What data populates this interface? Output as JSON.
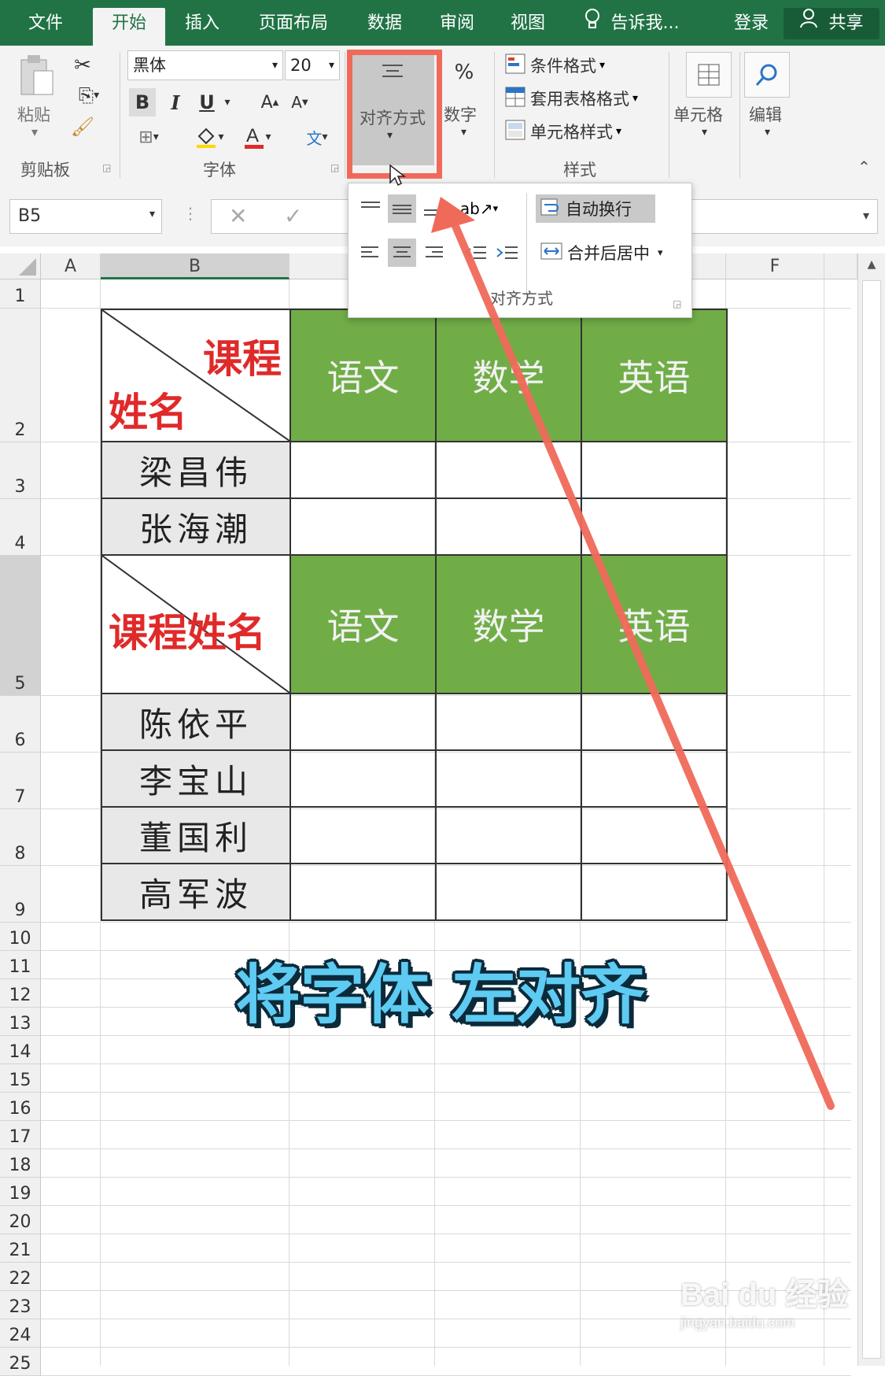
{
  "tabs": {
    "file": "文件",
    "home": "开始",
    "insert": "插入",
    "layout": "页面布局",
    "data": "数据",
    "review": "审阅",
    "view": "视图",
    "tell_me": "告诉我...",
    "login": "登录",
    "share": "共享"
  },
  "ribbon": {
    "paste": "粘贴",
    "clipboard_group": "剪贴板",
    "font_name": "黑体",
    "font_size": "20",
    "font_group": "字体",
    "bold": "B",
    "italic": "I",
    "underline": "U",
    "alignment_button": "对齐方式",
    "number_button": "数字",
    "conditional_format": "条件格式",
    "table_format": "套用表格格式",
    "cell_styles": "单元格样式",
    "styles_group": "样式",
    "cells_button": "单元格",
    "edit_button": "编辑"
  },
  "formula_bar": {
    "name_box": "B5"
  },
  "dropdown": {
    "wrap_text": "自动换行",
    "merge_center": "合并后居中",
    "group_label": "对齐方式"
  },
  "columns": [
    "A",
    "B",
    "F"
  ],
  "rows": [
    "1",
    "2",
    "3",
    "4",
    "5",
    "6",
    "7",
    "8",
    "9",
    "10",
    "11",
    "12",
    "13",
    "14",
    "15",
    "16",
    "17",
    "18",
    "19",
    "20",
    "21",
    "22",
    "23",
    "24",
    "25"
  ],
  "table1": {
    "header_top": "课程",
    "header_bottom": "姓名",
    "subjects": [
      "语文",
      "数学",
      "英语"
    ],
    "names": [
      "梁昌伟",
      "张海潮"
    ]
  },
  "table2": {
    "header": "课程姓名",
    "subjects": [
      "语文",
      "数学",
      "英语"
    ],
    "names": [
      "陈依平",
      "李宝山",
      "董国利",
      "高军波"
    ]
  },
  "caption": "将字体 左对齐",
  "watermark": {
    "logo": "Bai du 经验",
    "url": "jingyan.baidu.com"
  },
  "colors": {
    "excel_green": "#217346",
    "header_fill": "#70ad47",
    "red_text": "#e02a2a",
    "highlight": "#f06a5a"
  }
}
